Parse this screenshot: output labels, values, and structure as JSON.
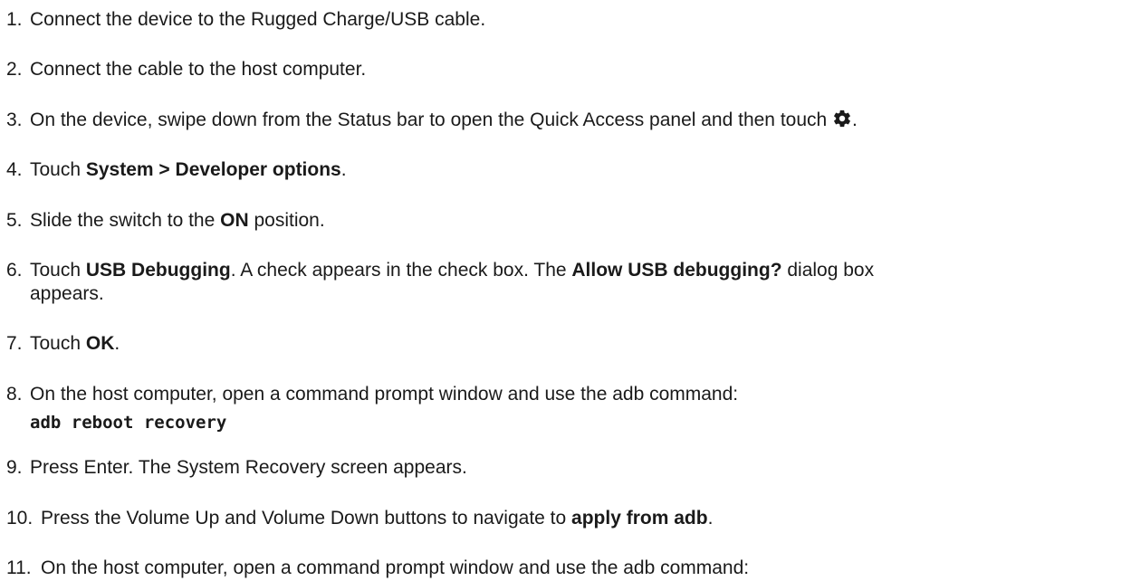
{
  "steps": [
    {
      "num": "1.",
      "text": "Connect the device to the Rugged Charge/USB cable."
    },
    {
      "num": "2.",
      "text": "Connect the cable to the host computer."
    },
    {
      "num": "3.",
      "text_before": "On the device, swipe down from the Status bar to open the Quick Access panel and then touch ",
      "icon": "settings-gear-icon",
      "text_after": "."
    },
    {
      "num": "4.",
      "pre": "Touch ",
      "b1": "System",
      "mid": " > ",
      "b2": "Developer options",
      "post": "."
    },
    {
      "num": "5.",
      "pre": "Slide the switch to the ",
      "b1": "ON",
      "post": " position."
    },
    {
      "num": "6.",
      "pre": "Touch ",
      "b1": "USB Debugging",
      "mid": ". A check appears in the check box. The ",
      "b2": "Allow USB debugging?",
      "post": " dialog box",
      "line2": "appears."
    },
    {
      "num": "7.",
      "pre": "Touch ",
      "b1": "OK",
      "post": "."
    },
    {
      "num": "8.",
      "text": "On the host computer, open a command prompt window and use the adb command:",
      "code": "adb reboot recovery"
    },
    {
      "num": "9.",
      "text": "Press Enter. The System Recovery screen appears."
    },
    {
      "num": "10.",
      "pre": "Press the Volume Up and Volume Down buttons to navigate to ",
      "b1": "apply from adb",
      "post": "."
    },
    {
      "num": "11.",
      "text": "On the host computer, open a command prompt window and use the adb command:"
    }
  ]
}
